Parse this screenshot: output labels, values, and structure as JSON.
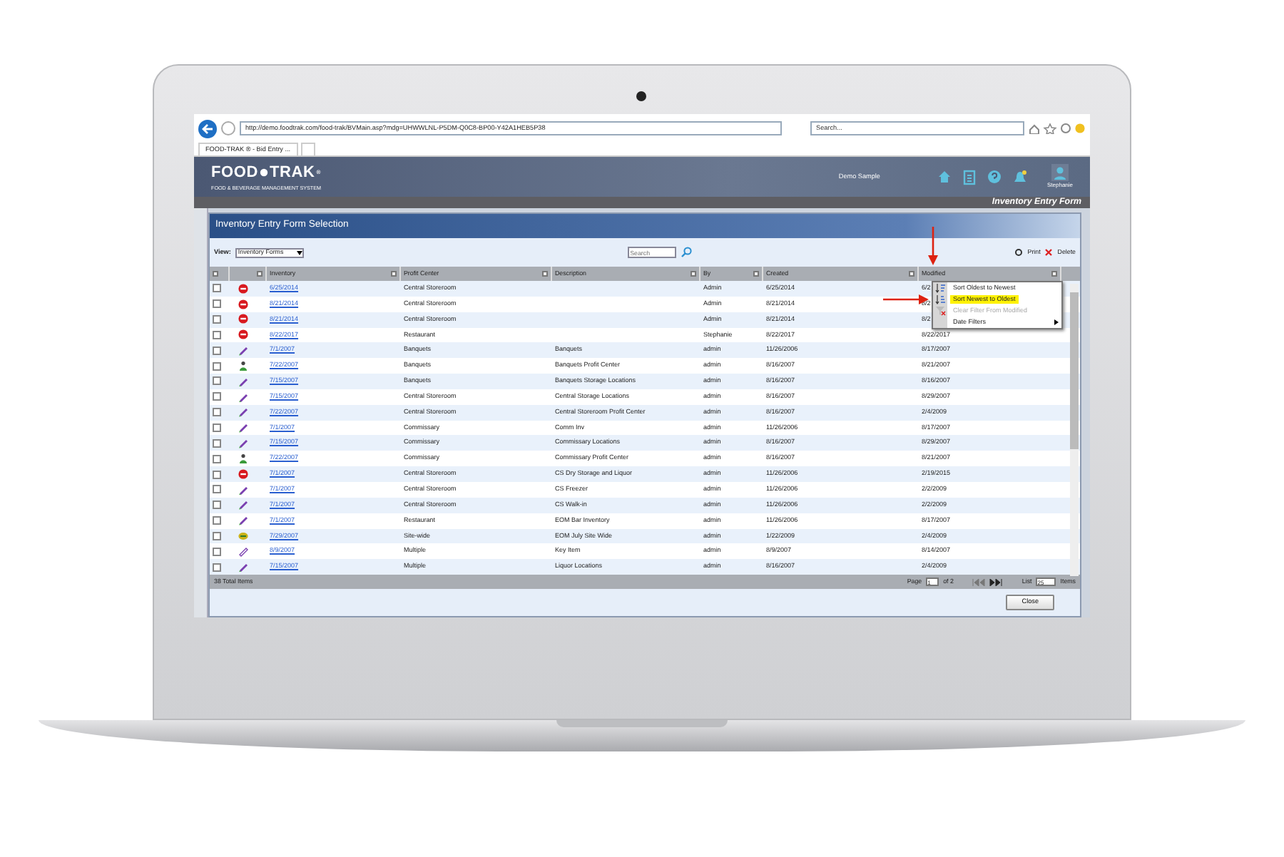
{
  "browser": {
    "url": "http://demo.foodtrak.com/food-trak/BVMain.asp?mdg=UHWWLNL-P5DM-Q0C8-BP00-Y42A1HEB5P38",
    "search_placeholder": "Search...",
    "tab_title": "FOOD-TRAK ® - Bid Entry ..."
  },
  "app_header": {
    "logo_left": "FOOD",
    "logo_right": "TRAK",
    "logo_mark": "®",
    "tagline": "FOOD & BEVERAGE MANAGEMENT SYSTEM",
    "site": "Demo Sample",
    "user": "Stephanie",
    "page_title": "Inventory Entry Form"
  },
  "dialog": {
    "title": "Inventory Entry Form Selection",
    "view_label": "View:",
    "view_value": "Inventory Forms",
    "search_placeholder": "Search",
    "print": "Print",
    "delete": "Delete",
    "columns": [
      "Inventory",
      "Profit Center",
      "Description",
      "By",
      "Created",
      "Modified"
    ],
    "rows": [
      {
        "checked": false,
        "kind": "stopped",
        "inventory": "6/25/2014",
        "profit_center": "Central Storeroom",
        "description": "",
        "by": "Admin",
        "created": "6/25/2014",
        "modified": "6/2"
      },
      {
        "checked": false,
        "kind": "stopped",
        "inventory": "8/21/2014",
        "profit_center": "Central Storeroom",
        "description": "",
        "by": "Admin",
        "created": "8/21/2014",
        "modified": "8/2"
      },
      {
        "checked": false,
        "kind": "stopped",
        "inventory": "8/21/2014",
        "profit_center": "Central Storeroom",
        "description": "",
        "by": "Admin",
        "created": "8/21/2014",
        "modified": "8/2"
      },
      {
        "checked": false,
        "kind": "stopped",
        "inventory": "8/22/2017",
        "profit_center": "Restaurant",
        "description": "",
        "by": "Stephanie",
        "created": "8/22/2017",
        "modified": "8/22/2017"
      },
      {
        "checked": false,
        "kind": "pencil",
        "inventory": "7/1/2007",
        "profit_center": "Banquets",
        "description": "Banquets",
        "by": "admin",
        "created": "11/26/2006",
        "modified": "8/17/2007"
      },
      {
        "checked": false,
        "kind": "person",
        "inventory": "7/22/2007",
        "profit_center": "Banquets",
        "description": "Banquets Profit Center",
        "by": "admin",
        "created": "8/16/2007",
        "modified": "8/21/2007"
      },
      {
        "checked": false,
        "kind": "pencil",
        "inventory": "7/15/2007",
        "profit_center": "Banquets",
        "description": "Banquets Storage Locations",
        "by": "admin",
        "created": "8/16/2007",
        "modified": "8/16/2007"
      },
      {
        "checked": false,
        "kind": "pencil",
        "inventory": "7/15/2007",
        "profit_center": "Central Storeroom",
        "description": "Central Storage Locations",
        "by": "admin",
        "created": "8/16/2007",
        "modified": "8/29/2007"
      },
      {
        "checked": false,
        "kind": "pencil",
        "inventory": "7/22/2007",
        "profit_center": "Central Storeroom",
        "description": "Central Storeroom Profit Center",
        "by": "admin",
        "created": "8/16/2007",
        "modified": "2/4/2009"
      },
      {
        "checked": false,
        "kind": "pencil",
        "inventory": "7/1/2007",
        "profit_center": "Commissary",
        "description": "Comm Inv",
        "by": "admin",
        "created": "11/26/2006",
        "modified": "8/17/2007"
      },
      {
        "checked": false,
        "kind": "pencil",
        "inventory": "7/15/2007",
        "profit_center": "Commissary",
        "description": "Commissary Locations",
        "by": "admin",
        "created": "8/16/2007",
        "modified": "8/29/2007"
      },
      {
        "checked": false,
        "kind": "person",
        "inventory": "7/22/2007",
        "profit_center": "Commissary",
        "description": "Commissary Profit Center",
        "by": "admin",
        "created": "8/16/2007",
        "modified": "8/21/2007"
      },
      {
        "checked": false,
        "kind": "stopped",
        "inventory": "7/1/2007",
        "profit_center": "Central Storeroom",
        "description": "CS Dry Storage and Liquor",
        "by": "admin",
        "created": "11/26/2006",
        "modified": "2/19/2015"
      },
      {
        "checked": false,
        "kind": "pencil",
        "inventory": "7/1/2007",
        "profit_center": "Central Storeroom",
        "description": "CS Freezer",
        "by": "admin",
        "created": "11/26/2006",
        "modified": "2/2/2009"
      },
      {
        "checked": false,
        "kind": "pencil",
        "inventory": "7/1/2007",
        "profit_center": "Central Storeroom",
        "description": "CS Walk-in",
        "by": "admin",
        "created": "11/26/2006",
        "modified": "2/2/2009"
      },
      {
        "checked": false,
        "kind": "pencil",
        "inventory": "7/1/2007",
        "profit_center": "Restaurant",
        "description": "EOM Bar Inventory",
        "by": "admin",
        "created": "11/26/2006",
        "modified": "8/17/2007"
      },
      {
        "checked": false,
        "kind": "site",
        "inventory": "7/29/2007",
        "profit_center": "Site-wide",
        "description": "EOM July Site Wide",
        "by": "admin",
        "created": "1/22/2009",
        "modified": "2/4/2009"
      },
      {
        "checked": false,
        "kind": "outline",
        "inventory": "8/9/2007",
        "profit_center": "Multiple",
        "description": "Key Item",
        "by": "admin",
        "created": "8/9/2007",
        "modified": "8/14/2007"
      },
      {
        "checked": false,
        "kind": "pencil",
        "inventory": "7/15/2007",
        "profit_center": "Multiple",
        "description": "Liquor Locations",
        "by": "admin",
        "created": "8/16/2007",
        "modified": "2/4/2009"
      }
    ],
    "total": "38 Total Items",
    "page_label": "Page",
    "page_value": "1",
    "page_of": "of 2",
    "list_label": "List",
    "list_value": "25",
    "items_label": "Items",
    "close": "Close"
  },
  "column_menu": {
    "items": [
      {
        "kind": "sort_asc",
        "label": "Sort Oldest to Newest",
        "selected": false,
        "disabled": false
      },
      {
        "kind": "sort_desc",
        "label": "Sort Newest to Oldest",
        "selected": true,
        "disabled": false
      },
      {
        "kind": "clear_filter",
        "label": "Clear Filter From Modified",
        "selected": false,
        "disabled": true
      },
      {
        "kind": "submenu",
        "label": "Date Filters",
        "selected": false,
        "disabled": false
      }
    ]
  }
}
